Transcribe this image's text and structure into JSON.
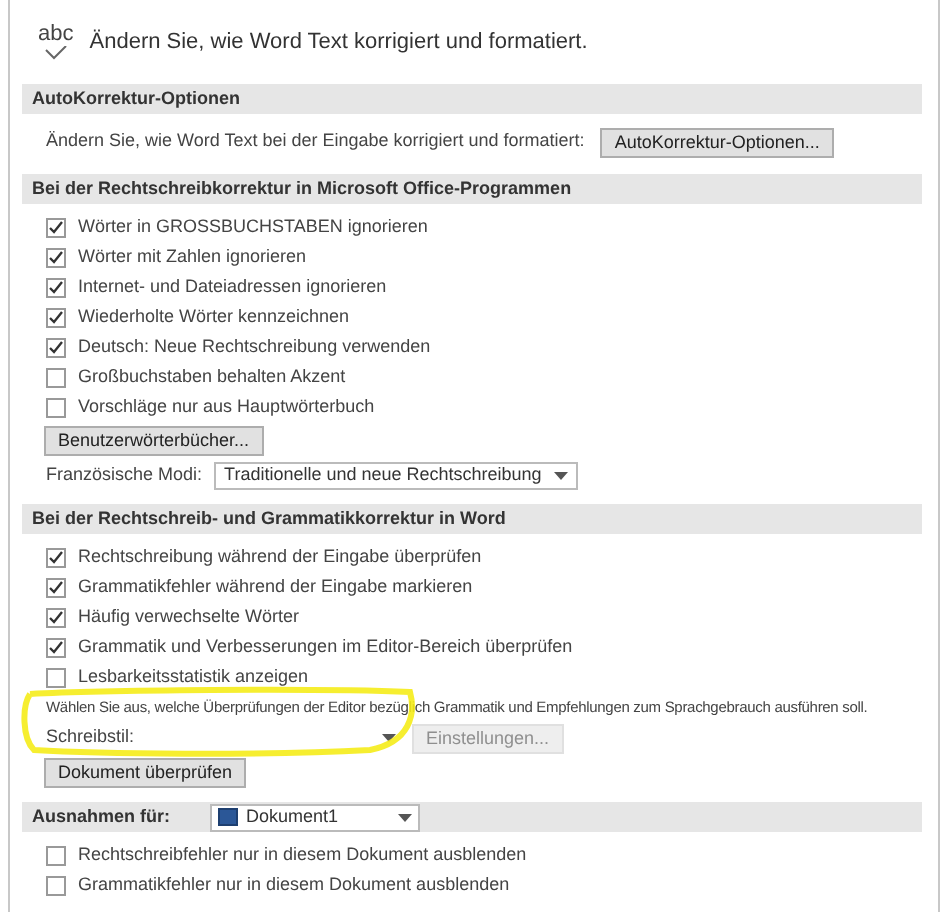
{
  "header": {
    "icon_text": "abc",
    "title": "Ändern Sie, wie Word Text korrigiert und formatiert."
  },
  "sections": [
    {
      "heading": "AutoKorrektur-Optionen",
      "items": [
        {
          "kind": "text_button",
          "text": "Ändern Sie, wie Word Text bei der Eingabe korrigiert und formatiert:",
          "button": "AutoKorrektur-Optionen..."
        }
      ]
    },
    {
      "heading": "Bei der Rechtschreibkorrektur in Microsoft Office-Programmen",
      "items": [
        {
          "kind": "checkbox",
          "label": "Wörter in GROSSBUCHSTABEN ignorieren",
          "checked": true
        },
        {
          "kind": "checkbox",
          "label": "Wörter mit Zahlen ignorieren",
          "checked": true
        },
        {
          "kind": "checkbox",
          "label": "Internet- und Dateiadressen ignorieren",
          "checked": true
        },
        {
          "kind": "checkbox",
          "label": "Wiederholte Wörter kennzeichnen",
          "checked": true
        },
        {
          "kind": "checkbox",
          "label": "Deutsch: Neue Rechtschreibung verwenden",
          "checked": true
        },
        {
          "kind": "checkbox",
          "label": "Großbuchstaben behalten Akzent",
          "checked": false
        },
        {
          "kind": "checkbox",
          "label": "Vorschläge nur aus Hauptwörterbuch",
          "checked": false
        },
        {
          "kind": "button",
          "label": "Benutzerwörterbücher..."
        },
        {
          "kind": "dropdown",
          "label": "Französische Modi:",
          "value": "Traditionelle und neue Rechtschreibung"
        }
      ]
    },
    {
      "heading": "Bei der Rechtschreib- und Grammatikkorrektur in Word",
      "items": [
        {
          "kind": "checkbox",
          "label": "Rechtschreibung während der Eingabe überprüfen",
          "checked": true
        },
        {
          "kind": "checkbox",
          "label": "Grammatikfehler während der Eingabe markieren",
          "checked": true
        },
        {
          "kind": "checkbox",
          "label": "Häufig verwechselte Wörter",
          "checked": true
        },
        {
          "kind": "checkbox",
          "label": "Grammatik und Verbesserungen im Editor-Bereich überprüfen",
          "checked": true
        },
        {
          "kind": "checkbox",
          "label": "Lesbarkeitsstatistik anzeigen",
          "checked": false
        },
        {
          "kind": "note",
          "text": "Wählen Sie aus, welche Überprüfungen der Editor bezüglich Grammatik und Empfehlungen zum Sprachgebrauch ausführen soll."
        },
        {
          "kind": "style_row",
          "label": "Schreibstil:",
          "button": "Einstellungen...",
          "disabled": true
        },
        {
          "kind": "button",
          "label": "Dokument überprüfen"
        }
      ]
    },
    {
      "heading": "Ausnahmen für:",
      "heading_dropdown": "Dokument1",
      "items": [
        {
          "kind": "checkbox",
          "label": "Rechtschreibfehler nur in diesem Dokument ausblenden",
          "checked": false
        },
        {
          "kind": "checkbox",
          "label": "Grammatikfehler nur in diesem Dokument ausblenden",
          "checked": false
        }
      ]
    }
  ],
  "annotation": {
    "kind": "highlight"
  }
}
